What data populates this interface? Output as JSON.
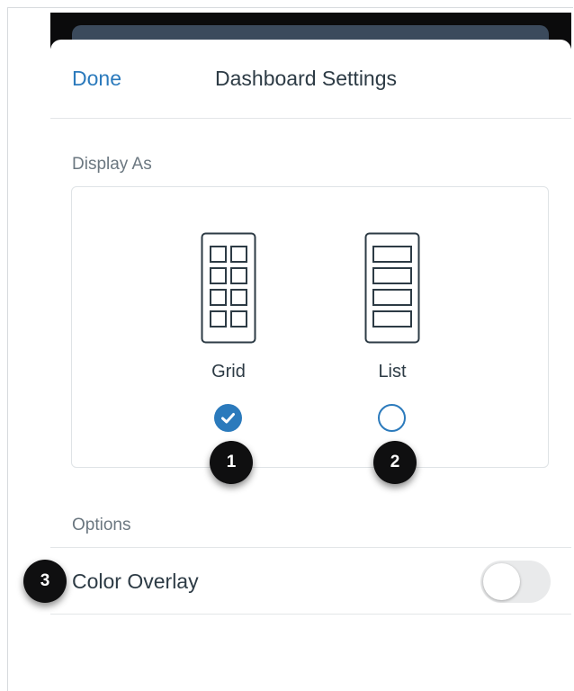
{
  "nav": {
    "done_label": "Done",
    "title": "Dashboard Settings"
  },
  "display": {
    "section_label": "Display As",
    "options": [
      {
        "label": "Grid",
        "icon": "grid-layout-icon",
        "selected": true
      },
      {
        "label": "List",
        "icon": "list-layout-icon",
        "selected": false
      }
    ]
  },
  "options_section": {
    "section_label": "Options",
    "color_overlay_label": "Color Overlay",
    "color_overlay_enabled": false
  },
  "callouts": [
    "1",
    "2",
    "3"
  ],
  "colors": {
    "accent": "#2b7abc",
    "text": "#2d3b45",
    "muted": "#6b7780",
    "badge": "#0f0f10"
  }
}
